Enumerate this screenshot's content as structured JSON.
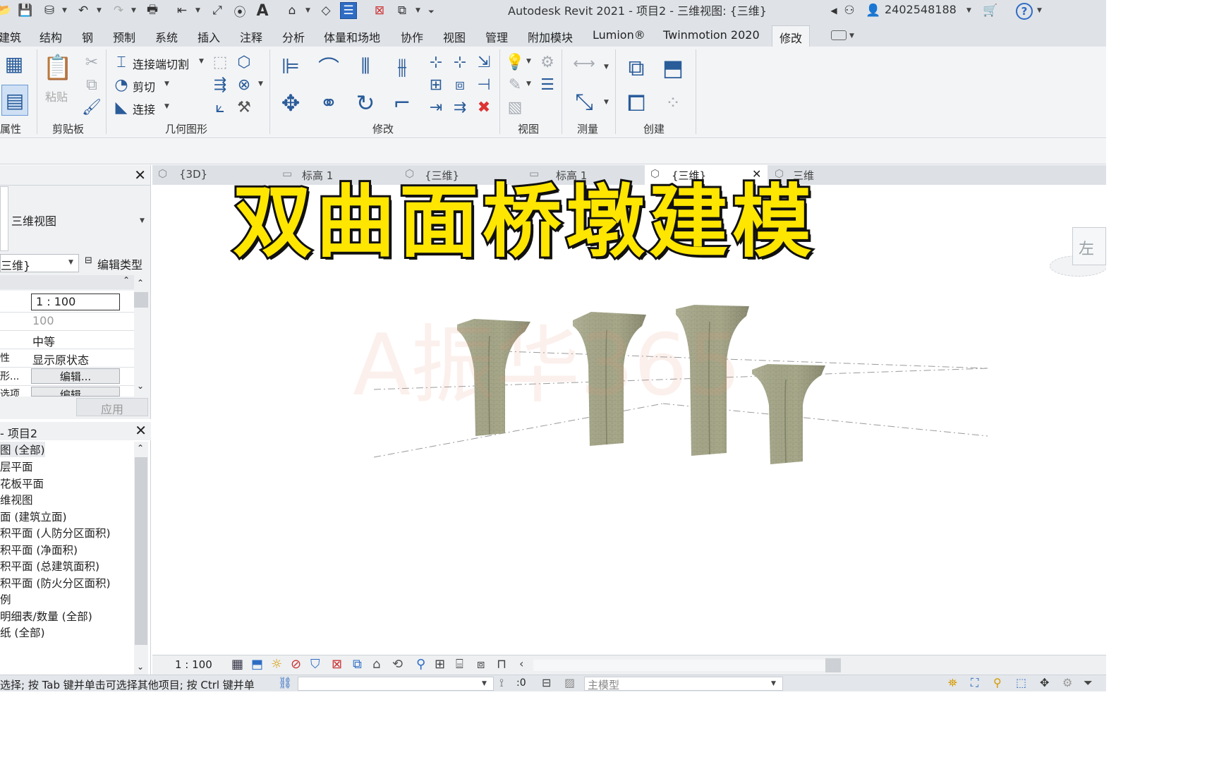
{
  "titlebar": {
    "title": "Autodesk Revit 2021 - 项目2 - 三维视图: {三维}",
    "user": "2402548188",
    "help": "?"
  },
  "menu": {
    "tabs": [
      "建筑",
      "结构",
      "钢",
      "预制",
      "系统",
      "插入",
      "注释",
      "分析",
      "体量和场地",
      "协作",
      "视图",
      "管理",
      "附加模块",
      "Lumion®",
      "Twinmotion 2020",
      "修改"
    ],
    "active": "修改"
  },
  "ribbon": {
    "panels": {
      "properties": "属性",
      "clipboard": "剪贴板",
      "geometry": "几何图形",
      "modify": "修改",
      "view": "视图",
      "measure": "测量",
      "create": "创建"
    },
    "paste": "粘贴",
    "cope": "连接端切割",
    "cut": "剪切",
    "join": "连接"
  },
  "properties_panel": {
    "type_name": "三维视图",
    "view_dropdown": "三维}",
    "edit_type": "编辑类型",
    "rows": [
      {
        "label": "",
        "value": "1 : 100"
      },
      {
        "label": "",
        "value": "100"
      },
      {
        "label": "",
        "value": "中等"
      },
      {
        "label": "性",
        "value": "显示原状态"
      },
      {
        "label": "形...",
        "value": "编辑..."
      },
      {
        "label": "选项",
        "value": "编辑..."
      }
    ],
    "apply": "应用"
  },
  "browser": {
    "title": "- 项目2",
    "items": [
      "图 (全部)",
      "层平面",
      "花板平面",
      "维视图",
      "面 (建筑立面)",
      "积平面 (人防分区面积)",
      "积平面 (净面积)",
      "积平面 (总建筑面积)",
      "积平面 (防火分区面积)",
      "例",
      "明细表/数量 (全部)",
      "纸 (全部)"
    ]
  },
  "view_tabs": [
    "{3D}",
    "标高 1",
    "{三维}",
    "标高 1",
    "{三维}",
    "三维"
  ],
  "overlay": {
    "title": "双曲面桥墩建模",
    "watermark": "A振华365"
  },
  "viewcube_label": "左",
  "viewbar": {
    "scale": "1 : 100"
  },
  "statusbar": {
    "hint": "选择; 按 Tab 键并单击可选择其他项目; 按 Ctrl 键并单",
    "count": ":0",
    "model": "主模型"
  }
}
